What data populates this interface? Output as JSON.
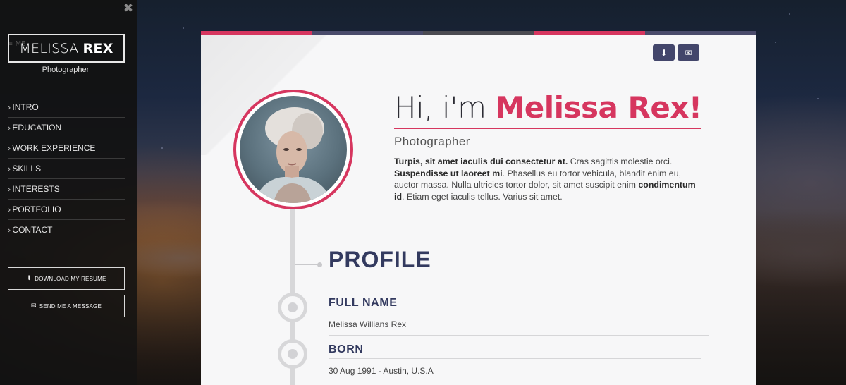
{
  "colors": {
    "accent": "#d6365f",
    "navy": "#333a5f",
    "button": "#43466b"
  },
  "sidebar": {
    "menu_ghost": "≡ ME",
    "first_name": "MELISSA",
    "last_name": "REX",
    "title": "Photographer",
    "nav": [
      {
        "label": "INTRO"
      },
      {
        "label": "EDUCATION"
      },
      {
        "label": "WORK EXPERIENCE"
      },
      {
        "label": "SKILLS"
      },
      {
        "label": "INTERESTS"
      },
      {
        "label": "PORTFOLIO"
      },
      {
        "label": "CONTACT"
      }
    ],
    "download_label": "DOWNLOAD MY RESUME",
    "message_label": "SEND ME A MESSAGE",
    "close_icon": "✖"
  },
  "topbar": {
    "colors": [
      "#d6365f",
      "#4a4b6b",
      "#444",
      "#d6365f",
      "#4a4b6b"
    ]
  },
  "actions": {
    "download_icon": "⬇",
    "mail_icon": "✉"
  },
  "hero": {
    "greeting": "Hi, i'm",
    "name": "Melissa Rex!",
    "subtitle": "Photographer",
    "intro_bold1": "Turpis, sit amet iaculis dui consectetur at.",
    "intro_text1": " Cras sagittis molestie orci. ",
    "intro_bold2": "Suspendisse ut laoreet mi",
    "intro_text2": ". Phasellus eu tortor vehicula, blandit enim eu, auctor massa. Nulla ultricies tortor dolor, sit amet suscipit enim ",
    "intro_bold3": "condimentum id",
    "intro_text3": ". Etiam eget iaculis tellus. Varius sit amet."
  },
  "profile": {
    "heading": "PROFILE",
    "fields": [
      {
        "label": "FULL NAME",
        "value": "Melissa Willians Rex"
      },
      {
        "label": "BORN",
        "value": "30 Aug 1991 - Austin, U.S.A"
      }
    ]
  }
}
